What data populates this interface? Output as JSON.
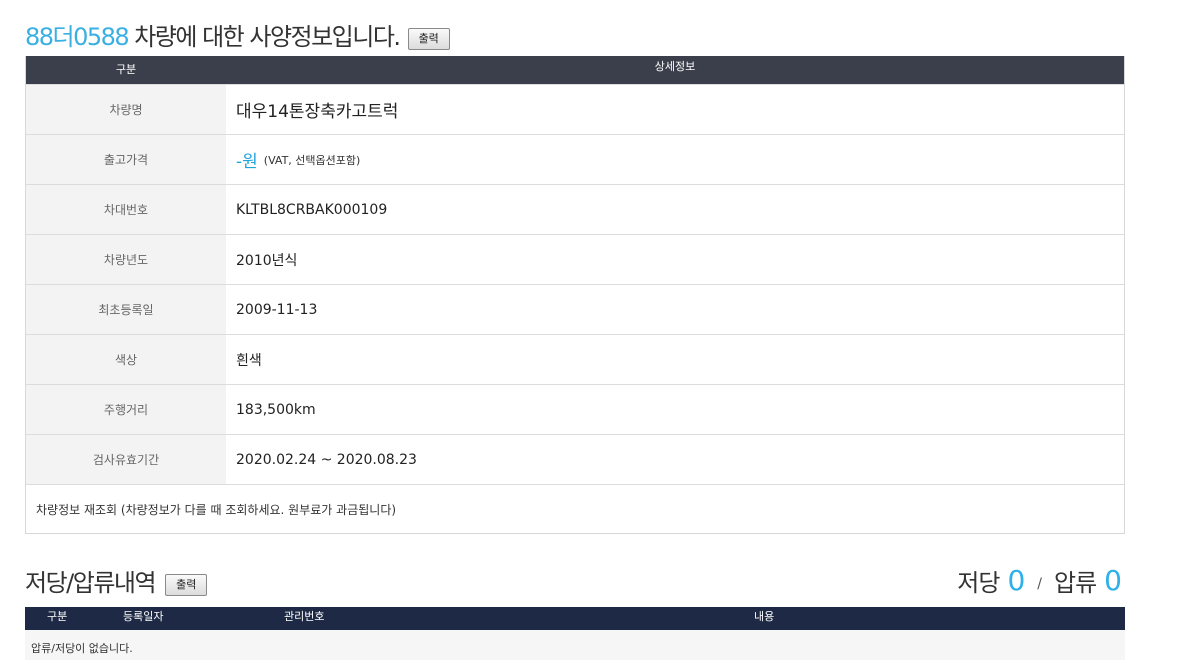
{
  "vehicle_section": {
    "plate": "88더0588",
    "title_suffix": "차량에 대한 사양정보입니다.",
    "print_label": "출력",
    "columns": [
      "구분",
      "상세정보"
    ],
    "rows": [
      {
        "label": "차량명",
        "value": "대우14톤장축카고트럭"
      },
      {
        "label": "출고가격",
        "value": "-원",
        "note": "(VAT, 선택옵션포함)"
      },
      {
        "label": "차대번호",
        "value": "KLTBL8CRBAK000109"
      },
      {
        "label": "차량년도",
        "value": "2010년식"
      },
      {
        "label": "최초등록일",
        "value": "2009-11-13"
      },
      {
        "label": "색상",
        "value": "흰색"
      },
      {
        "label": "주행거리",
        "value": "183,500km"
      },
      {
        "label": "검사유효기간",
        "value": "2020.02.24 ~ 2020.08.23"
      }
    ],
    "recheck_text": "차량정보 재조회 (차량정보가 다를 때 조회하세요. 원부료가 과금됩니다)"
  },
  "lien_section": {
    "title": "저당/압류내역",
    "print_label": "출력",
    "mortgage_label": "저당",
    "mortgage_count": "0",
    "separator": "/",
    "seizure_label": "압류",
    "seizure_count": "0",
    "columns": [
      "구분",
      "등록일자",
      "관리번호",
      "내용"
    ],
    "empty_text": "압류/저당이 없습니다."
  }
}
